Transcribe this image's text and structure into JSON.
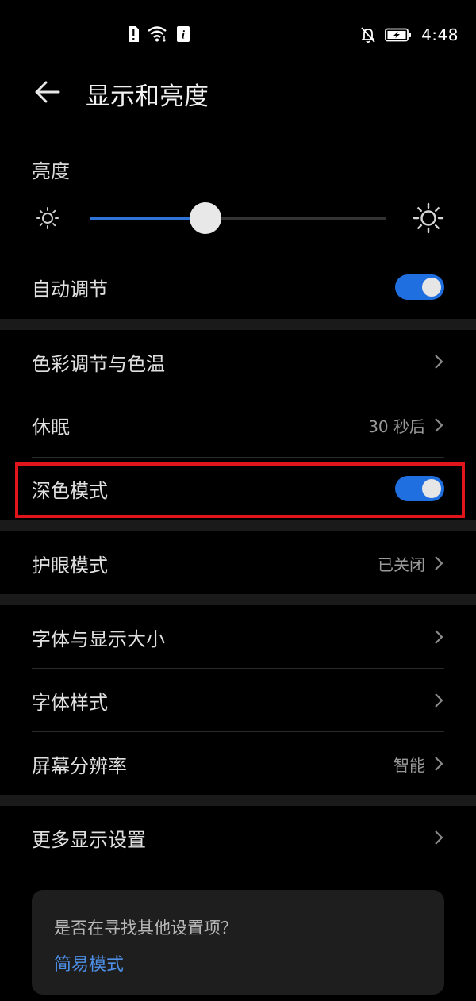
{
  "status_bar": {
    "time": "4:48",
    "icons_left": [
      "sim-alert-icon",
      "wifi-icon",
      "info-icon"
    ],
    "icons_right": [
      "notifications-off-icon",
      "battery-charging-icon"
    ]
  },
  "header": {
    "title": "显示和亮度"
  },
  "brightness": {
    "label": "亮度",
    "level": 0.39
  },
  "auto_adjust": {
    "label": "自动调节",
    "on": true
  },
  "color_temp": {
    "label": "色彩调节与色温"
  },
  "sleep": {
    "label": "休眠",
    "value": "30 秒后"
  },
  "dark_mode": {
    "label": "深色模式",
    "on": true
  },
  "eye_comfort": {
    "label": "护眼模式",
    "value": "已关闭"
  },
  "font_size": {
    "label": "字体与显示大小"
  },
  "font_style": {
    "label": "字体样式"
  },
  "resolution": {
    "label": "屏幕分辨率",
    "value": "智能"
  },
  "more_display": {
    "label": "更多显示设置"
  },
  "suggestion": {
    "question": "是否在寻找其他设置项？",
    "link": "简易模式"
  },
  "colors": {
    "accent": "#1f6fe0",
    "highlight": "#e0141b",
    "link": "#4d8fe6"
  }
}
